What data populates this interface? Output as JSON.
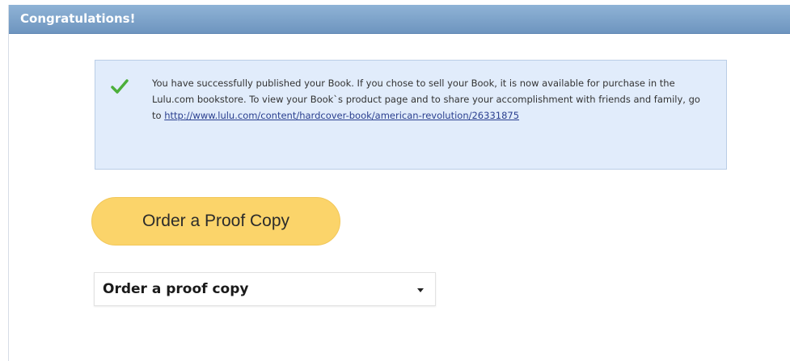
{
  "panel": {
    "title": "Congratulations!"
  },
  "notice": {
    "icon": "checkmark-icon",
    "icon_color": "#4caf3a",
    "message_prefix": "You have successfully published your Book. If you chose to sell your Book, it is now available for purchase in the Lulu.com bookstore. To view your Book`s product page and to share your accomplishment with friends and family, go to ",
    "link_text": "http://www.lulu.com/content/hardcover-book/american-revolution/26331875"
  },
  "actions": {
    "proof_button_label": "Order a Proof Copy",
    "proof_button_color": "#fbd46a",
    "select_value": "Order a proof copy",
    "select_caret_icon": "chevron-down-icon"
  },
  "colors": {
    "header": "#7ea4cb",
    "notice_bg": "#e1ecfb",
    "link": "#2a3f8f"
  }
}
